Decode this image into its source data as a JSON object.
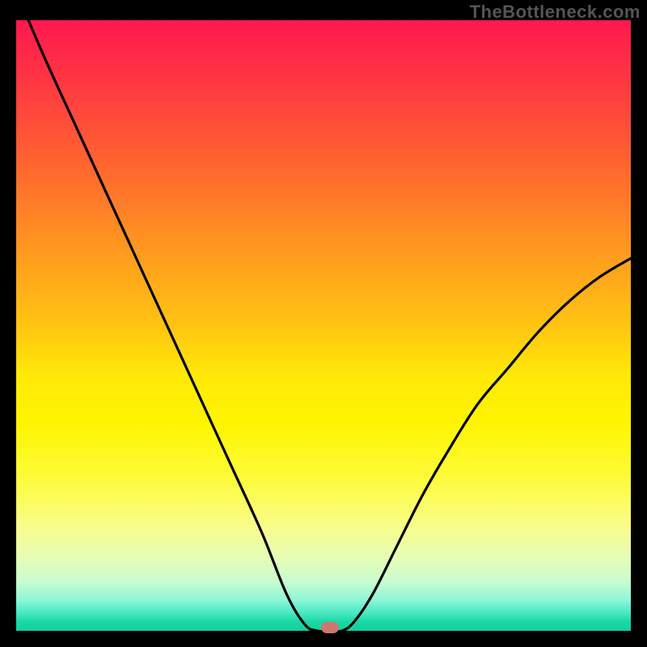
{
  "watermark": "TheBottleneck.com",
  "chart_data": {
    "type": "line",
    "title": "",
    "xlabel": "",
    "ylabel": "",
    "xlim": [
      0,
      100
    ],
    "ylim": [
      0,
      100
    ],
    "grid": false,
    "legend": false,
    "series": [
      {
        "name": "bottleneck-curve",
        "x": [
          2,
          5,
          10,
          15,
          20,
          25,
          30,
          35,
          40,
          44,
          47,
          49,
          51,
          53,
          55,
          58,
          62,
          66,
          70,
          75,
          80,
          85,
          90,
          95,
          100
        ],
        "y": [
          100,
          93,
          82,
          71,
          60,
          49,
          38,
          27,
          16,
          6,
          1,
          0,
          0,
          0,
          1.5,
          6,
          14,
          22,
          29,
          37,
          43,
          49,
          54,
          58,
          61
        ]
      }
    ],
    "annotations": [
      {
        "name": "minimum-point",
        "x": 51,
        "y": 0
      }
    ],
    "background": "vertical-gradient",
    "gradient_stops": [
      {
        "pct": 0,
        "color": "#ff1850"
      },
      {
        "pct": 25,
        "color": "#ff6a2e"
      },
      {
        "pct": 50,
        "color": "#ffc412"
      },
      {
        "pct": 75,
        "color": "#fdfb3a"
      },
      {
        "pct": 100,
        "color": "#12cf9a"
      }
    ]
  }
}
